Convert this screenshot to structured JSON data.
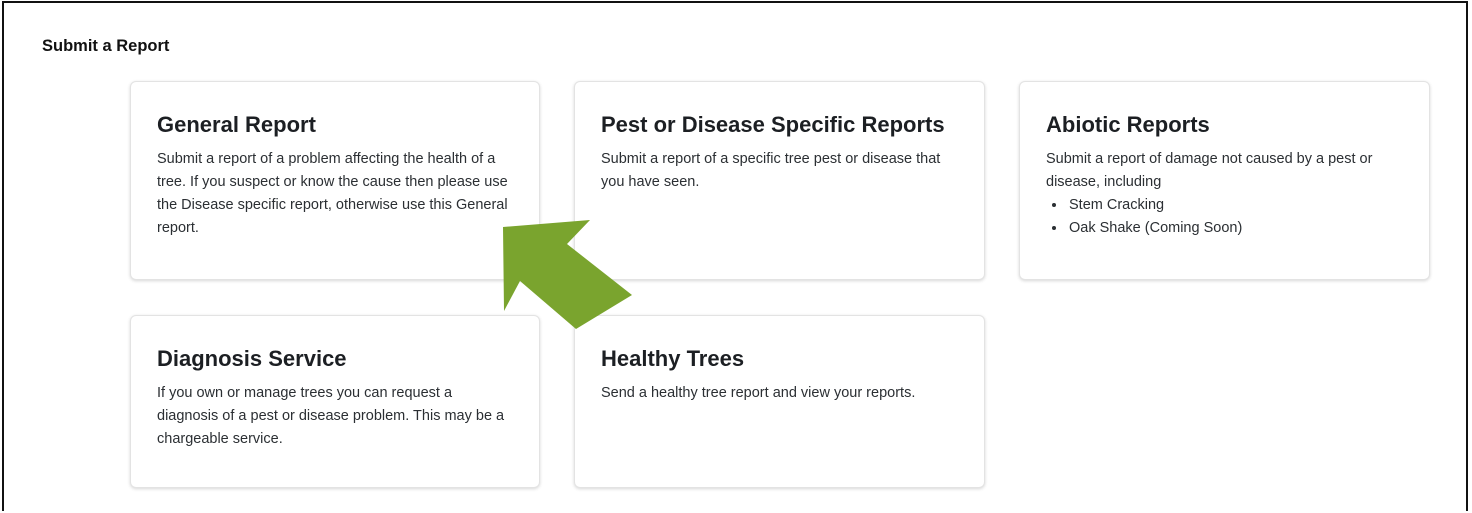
{
  "page": {
    "title": "Submit a Report"
  },
  "cards": {
    "general": {
      "title": "General Report",
      "description": "Submit a report of a problem affecting the health of a tree. If you suspect or know the cause then please use the Disease specific report, otherwise use this General report."
    },
    "pest": {
      "title": "Pest or Disease Specific Reports",
      "description": "Submit a report of a specific tree pest or disease that you have seen."
    },
    "abiotic": {
      "title": "Abiotic Reports",
      "description": "Submit a report of damage not caused by a pest or disease, including",
      "items": [
        "Stem Cracking",
        "Oak Shake (Coming Soon)"
      ]
    },
    "diagnosis": {
      "title": "Diagnosis Service",
      "description": "If you own or manage trees you can request a diagnosis of a pest or disease problem. This may be a chargeable service."
    },
    "healthy": {
      "title": "Healthy Trees",
      "description": "Send a healthy tree report and view your reports."
    }
  },
  "annotation": {
    "arrow_color": "#7aa42e",
    "arrow_direction": "up-right",
    "points_to": "Pest or Disease Specific Reports"
  }
}
